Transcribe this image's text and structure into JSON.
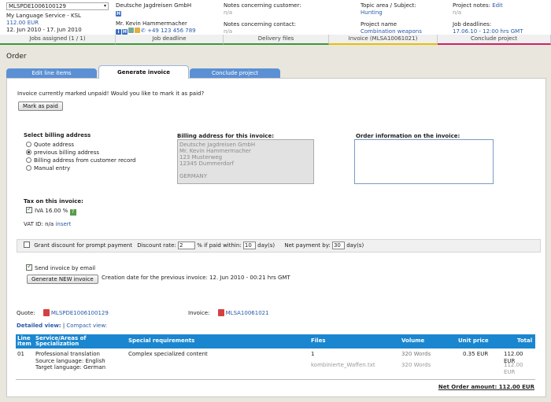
{
  "header": {
    "project_select": "MLSPDE1006100129",
    "company_name": "My Language Service - KSL",
    "price": "112.00 EUR",
    "date_range": "12. Jun 2010 - 17. Jun 2010",
    "customer": "Deutsche Jagdreisen GmbH",
    "contact": "Mr. Kevin Hammermacher",
    "phone": "+49 123 456 789",
    "notes_customer_label": "Notes concerning customer:",
    "notes_customer_val": "n/a",
    "notes_contact_label": "Notes concerning contact:",
    "notes_contact_val": "n/a",
    "topic_label": "Topic area / Subject:",
    "topic_val": "Hunting",
    "project_name_label": "Project name",
    "project_name_val": "Combination weapons",
    "project_notes_label": "Project notes:",
    "project_notes_edit": "Edit",
    "project_notes_val": "n/a",
    "deadlines_label": "Job deadlines:",
    "deadlines_val": "17.06.10 - 12:00 hrs GMT",
    "bars": [
      "Jobs assigned (1 / 1)",
      "Job deadline",
      "Delivery files",
      "Invoice (MLSA10061021)",
      "Conclude project"
    ]
  },
  "page_title": "Order",
  "tabs": [
    "Edit line items",
    "Generate invoice",
    "Conclude project"
  ],
  "invoice": {
    "unpaid_msg": "Invoice currently marked unpaid! Would you like to mark it as paid?",
    "mark_paid": "Mark as paid",
    "billing_title": "Select billing address",
    "billing_options": [
      "Quote address",
      "previous billing address",
      "Billing address from customer record",
      "Manual entry"
    ],
    "billing_addr_title": "Billing address for this invoice:",
    "billing_addr_lines": [
      "Deutsche Jagdreisen GmbH",
      "Mr. Kevin Hammermacher",
      "123 Musterweg",
      "12345 Dummerdorf",
      "",
      "GERMANY"
    ],
    "order_info_title": "Order information on the invoice:",
    "tax_title": "Tax on this invoice:",
    "tax_item": "IVA 16.00 %",
    "vat_label": "VAT ID: n/a",
    "vat_insert": "insert",
    "discount_label": "Grant discount for prompt payment",
    "discount_rate_label": "Discount rate:",
    "discount_rate": "2",
    "if_paid_label": "% if paid within:",
    "if_paid_days": "10",
    "days_label": "day(s)",
    "net_payment_label": "Net payment by:",
    "net_payment_days": "30",
    "send_email": "Send invoice by email",
    "generate_btn": "Generate NEW invoice",
    "creation_date": "Creation date for the previous invoice: 12. Jun 2010 - 00:21 hrs GMT",
    "quote_label": "Quote:",
    "quote_num": "MLSPDE1006100129",
    "invoice_label": "Invoice:",
    "invoice_num": "MLSA10061021",
    "detailed_view": "Detailed view:",
    "compact_view": "Compact view:"
  },
  "table": {
    "headers": [
      "Line item",
      "Service/Areas of Specialization",
      "Special requirements",
      "Files",
      "Volume",
      "Unit price",
      "Total"
    ],
    "row": {
      "num": "01",
      "service": "Professional translation",
      "src_lang": "Source language: English",
      "tgt_lang": "Target language: German",
      "requirements": "Complex specialized content",
      "files_count": "1",
      "file_name": "kombinierte_Waffen.txt",
      "volume1": "320 Words",
      "volume2": "320 Words",
      "unit_price": "0.35 EUR",
      "total1": "112.00 EUR",
      "total2": "112.00 EUR"
    },
    "net_amount": "Net Order amount: 112.00 EUR"
  }
}
